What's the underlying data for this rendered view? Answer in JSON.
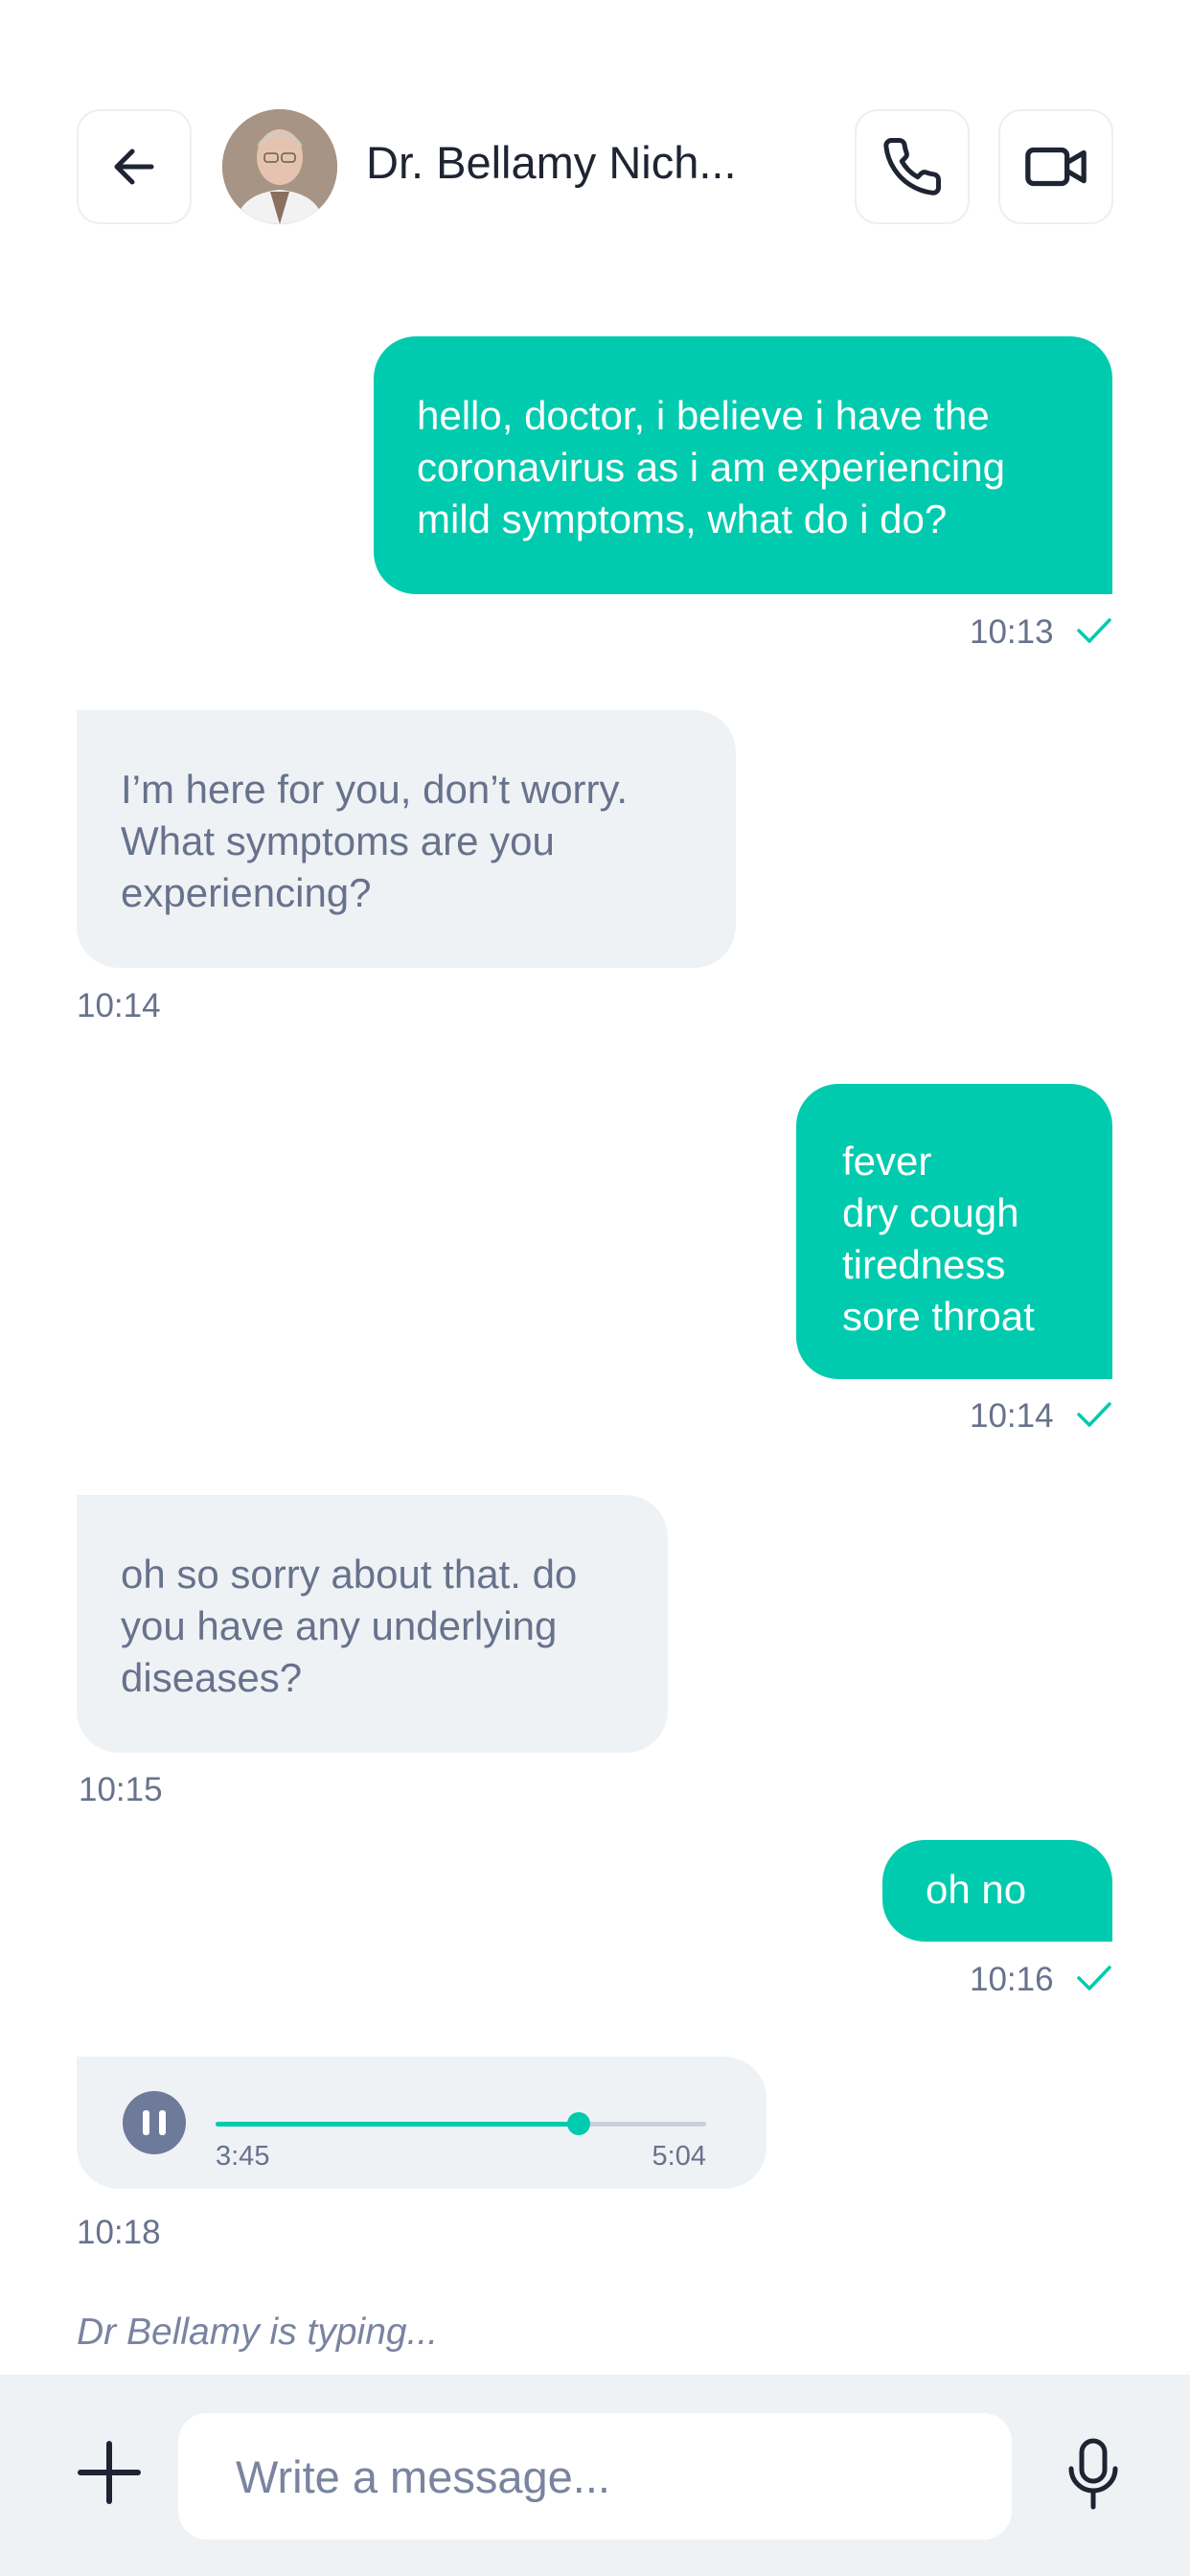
{
  "header": {
    "contact_name": "Dr. Bellamy Nich...",
    "icons": {
      "back": "arrow-left-icon",
      "call": "phone-icon",
      "video": "video-camera-icon"
    }
  },
  "messages": [
    {
      "direction": "outgoing",
      "lines": [
        "hello, doctor, i believe i have the",
        "coronavirus as i am experiencing",
        "mild symptoms, what do i do?"
      ],
      "time": "10:13",
      "status": "sent"
    },
    {
      "direction": "incoming",
      "lines": [
        "I’m here for you, don’t worry.",
        "What symptoms are you",
        "experiencing?"
      ],
      "time": "10:14"
    },
    {
      "direction": "outgoing",
      "lines": [
        "fever",
        "dry cough",
        "tiredness",
        "sore throat"
      ],
      "time": "10:14",
      "status": "sent"
    },
    {
      "direction": "incoming",
      "lines": [
        "oh so sorry about that. do",
        "you have any underlying",
        "diseases?"
      ],
      "time": "10:15"
    },
    {
      "direction": "outgoing",
      "lines": [
        "oh no"
      ],
      "time": "10:16",
      "status": "sent"
    }
  ],
  "voice_message": {
    "elapsed": "3:45",
    "duration": "5:04",
    "progress": 0.74,
    "time": "10:18"
  },
  "typing_indicator": "Dr Bellamy is typing...",
  "composer": {
    "placeholder": "Write a message...",
    "value": ""
  },
  "colors": {
    "accent": "#00cbae",
    "incoming_bubble": "#eff2f5",
    "text_muted": "#67728c",
    "text_dark": "#1f2433"
  }
}
